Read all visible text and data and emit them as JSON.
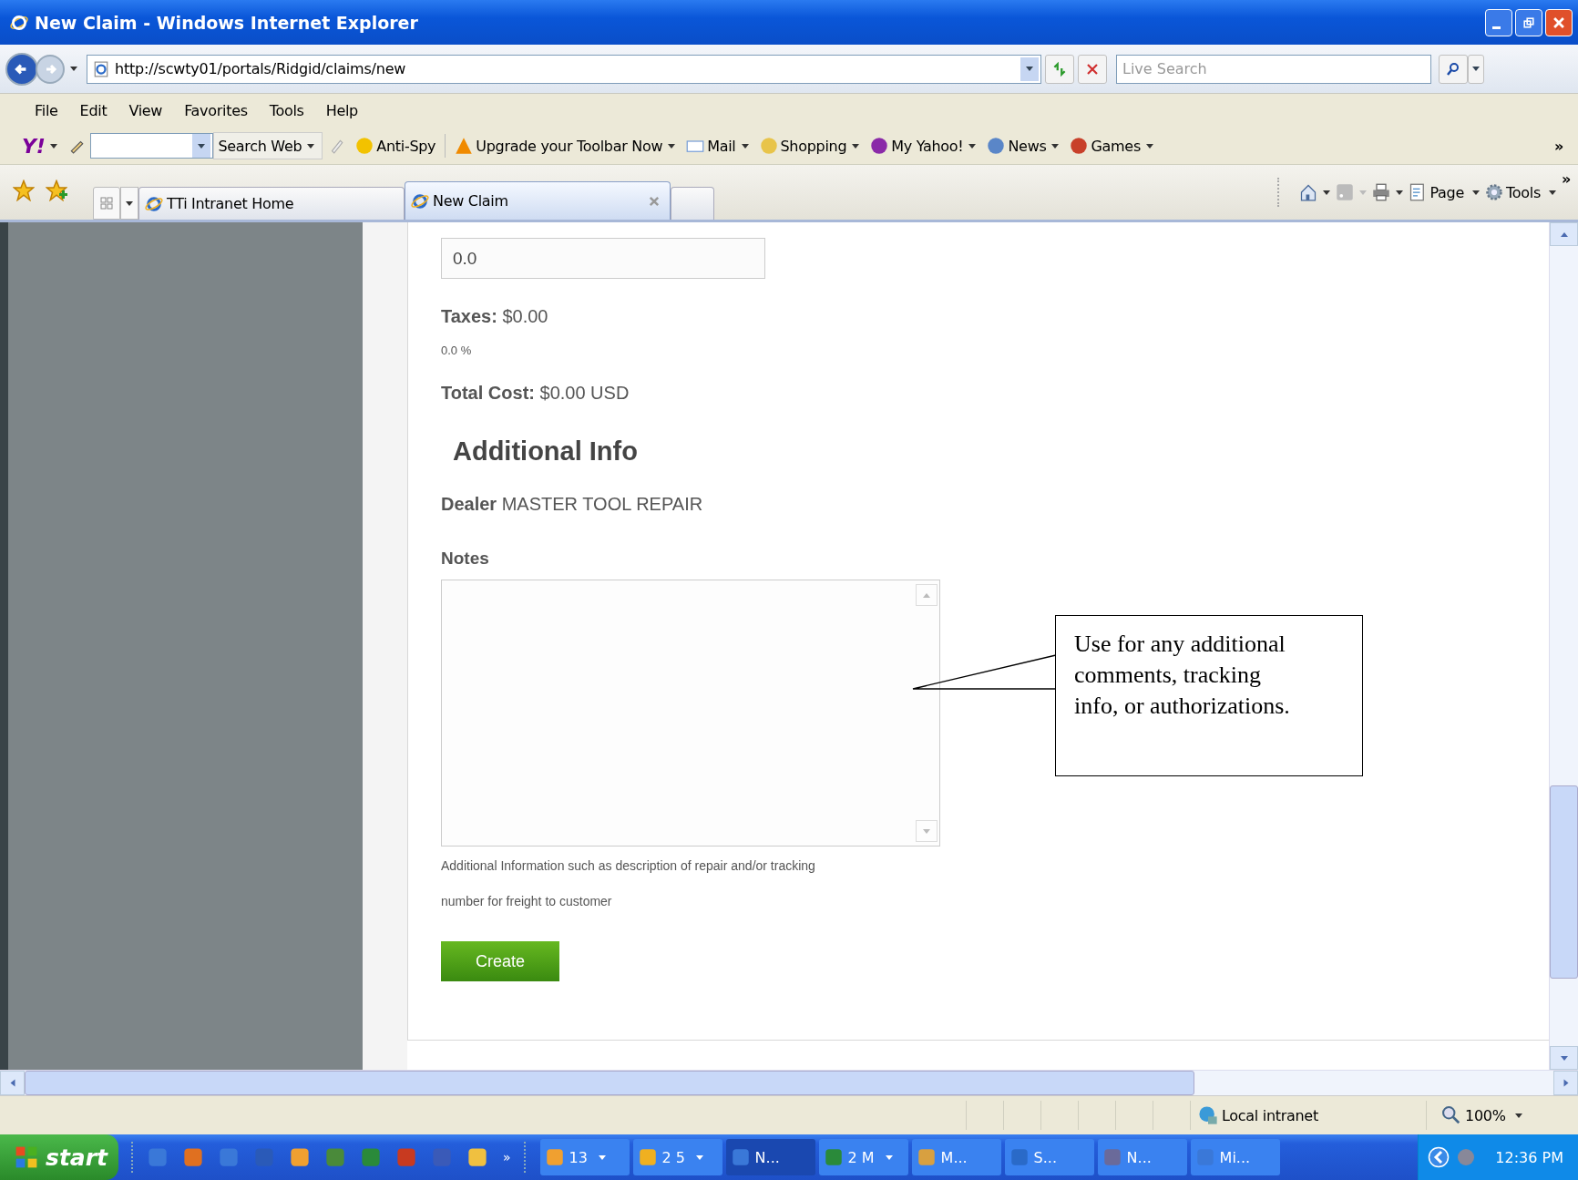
{
  "window": {
    "title": "New Claim - Windows Internet Explorer"
  },
  "address_bar": {
    "url": "http://scwty01/portals/Ridgid/claims/new",
    "search_placeholder": "Live Search"
  },
  "menu_bar": [
    "File",
    "Edit",
    "View",
    "Favorites",
    "Tools",
    "Help"
  ],
  "yahoo_toolbar": {
    "logo": "Y!",
    "search_button": "Search Web",
    "items": [
      "Anti-Spy",
      "Upgrade your Toolbar Now",
      "Mail",
      "Shopping",
      "My Yahoo!",
      "News",
      "Games"
    ],
    "overflow": "»"
  },
  "tabs": [
    {
      "label": "TTi Intranet Home",
      "selected": false
    },
    {
      "label": "New Claim",
      "selected": true
    }
  ],
  "command_bar": {
    "items": [
      "Page",
      "Tools"
    ],
    "overflow": "»"
  },
  "form": {
    "labor_cost_value": "0.0",
    "taxes": {
      "label": "Taxes:",
      "value": "$0.00",
      "rate": "0.0 %"
    },
    "total": {
      "label": "Total Cost:",
      "value": "$0.00 USD"
    },
    "section_title": "Additional Info",
    "dealer": {
      "label": "Dealer",
      "value": "MASTER TOOL REPAIR"
    },
    "notes": {
      "label": "Notes",
      "help_lines": [
        "Additional Information such as description of repair and/or tracking",
        "number for freight to customer"
      ]
    },
    "submit": "Create"
  },
  "callout": {
    "text": "Use for any additional comments, tracking info, or authorizations."
  },
  "status_bar": {
    "zone": "Local intranet",
    "zoom": "100%"
  },
  "taskbar": {
    "start": "start",
    "overflow": "»",
    "tasks": [
      {
        "label": "13",
        "dropdown": true,
        "selected": false
      },
      {
        "label": "2 5",
        "dropdown": true,
        "selected": false
      },
      {
        "label": "N...",
        "dropdown": false,
        "selected": true
      },
      {
        "label": "2 M",
        "dropdown": true,
        "selected": false
      },
      {
        "label": "M...",
        "dropdown": false,
        "selected": false
      },
      {
        "label": "S...",
        "dropdown": false,
        "selected": false
      },
      {
        "label": "N...",
        "dropdown": false,
        "selected": false
      },
      {
        "label": "Mi...",
        "dropdown": false,
        "selected": false
      }
    ],
    "clock": "12:36 PM"
  }
}
